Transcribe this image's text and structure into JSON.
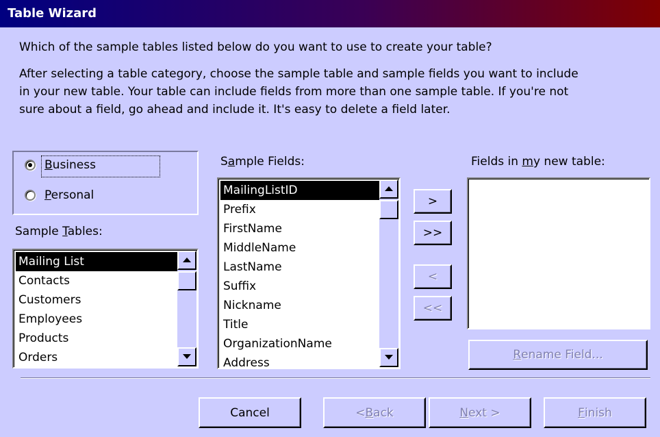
{
  "window": {
    "title": "Table Wizard"
  },
  "question": "Which of the sample tables listed below do you want to use to create your table?",
  "instructions": [
    "After selecting a table category, choose the sample table and sample fields you want to include",
    "in your new table. Your table can include fields from more than one sample table. If you're not",
    "sure about a field, go ahead and include it. It's easy to delete a field later."
  ],
  "category": {
    "selected": "Business",
    "options": [
      {
        "pre": "",
        "key": "B",
        "post": "usiness"
      },
      {
        "pre": "",
        "key": "P",
        "post": "ersonal"
      }
    ]
  },
  "sample_tables": {
    "label": {
      "pre": "Sample ",
      "key": "T",
      "post": "ables:"
    },
    "items": [
      "Mailing List",
      "Contacts",
      "Customers",
      "Employees",
      "Products",
      "Orders"
    ],
    "selected_index": 0
  },
  "sample_fields": {
    "label": {
      "pre": "S",
      "key": "a",
      "post": "mple Fields:"
    },
    "items": [
      "MailingListID",
      "Prefix",
      "FirstName",
      "MiddleName",
      "LastName",
      "Suffix",
      "Nickname",
      "Title",
      "OrganizationName",
      "Address"
    ],
    "selected_index": 0
  },
  "new_fields": {
    "label": {
      "pre": "Fields in ",
      "key": "m",
      "post": "y new table:"
    },
    "items": []
  },
  "move_buttons": {
    "add": ">",
    "add_all": ">>",
    "remove": "<",
    "remove_all": "<<"
  },
  "rename_button": {
    "key": "R",
    "post": "ename Field..."
  },
  "footer": {
    "cancel": "Cancel",
    "back": {
      "pre": "< ",
      "key": "B",
      "post": "ack"
    },
    "next": {
      "key": "N",
      "post": "ext >"
    },
    "finish": {
      "key": "F",
      "post": "inish"
    }
  }
}
